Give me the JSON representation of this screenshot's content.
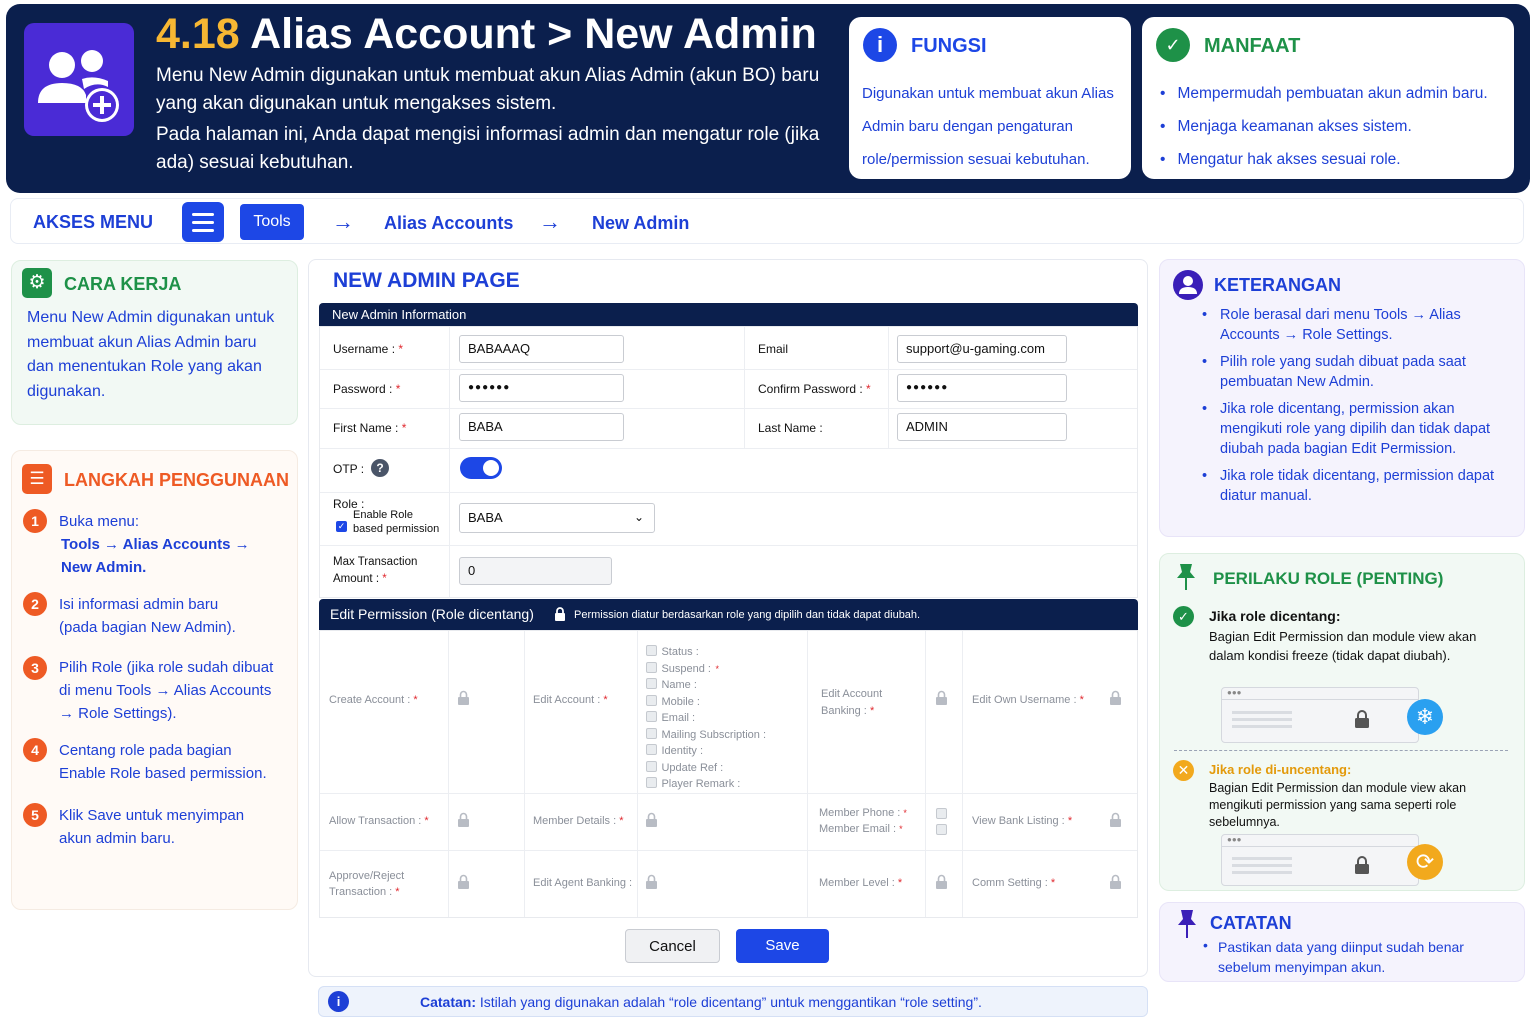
{
  "header": {
    "title_num": "4.18",
    "title_rest": "Alias Account > New Admin",
    "desc1": "Menu New Admin digunakan untuk membuat akun Alias Admin (akun BO) baru yang akan digunakan untuk mengakses sistem.",
    "desc2": "Pada halaman ini, Anda dapat mengisi informasi admin dan mengatur role (jika ada) sesuai kebutuhan.",
    "fungsi": {
      "title": "FUNGSI",
      "icon": "info-icon",
      "text": "Digunakan untuk membuat akun Alias Admin baru dengan pengaturan role/permission sesuai kebutuhan."
    },
    "manfaat": {
      "title": "MANFAAT",
      "icon": "check-circle-icon",
      "items": [
        "Mempermudah pembuatan akun admin baru.",
        "Menjaga keamanan akses sistem.",
        "Mengatur hak akses sesuai role."
      ]
    }
  },
  "akses": {
    "title": "AKSES MENU",
    "tools": "Tools",
    "crumb1": "Alias Accounts",
    "crumb2": "New Admin"
  },
  "cara": {
    "title": "CARA KERJA",
    "text": "Menu New Admin digunakan untuk membuat akun Alias Admin baru dan menentukan Role yang akan digunakan."
  },
  "langkah": {
    "title": "LANGKAH PENGGUNAAN",
    "steps": [
      {
        "n": "1",
        "a": "Buka menu:",
        "b": "Tools → Alias Accounts →",
        "c": "New Admin."
      },
      {
        "n": "2",
        "a": "Isi informasi admin baru",
        "b": "(pada bagian New Admin)."
      },
      {
        "n": "3",
        "a": "Pilih Role (jika role sudah dibuat",
        "b": "di menu Tools → Alias Accounts",
        "c": "→ Role Settings)."
      },
      {
        "n": "4",
        "a": "Centang role pada bagian",
        "b": "Enable Role based permission."
      },
      {
        "n": "5",
        "a": "Klik Save untuk menyimpan",
        "b": "akun admin baru."
      }
    ]
  },
  "form": {
    "page_title": "NEW ADMIN PAGE",
    "section1": "New Admin Information",
    "username_label": "Username :",
    "username_value": "BABAAAQ",
    "email_label": "Email",
    "email_value": "support@u-gaming.com",
    "password_label": "Password :",
    "password_value": "●●●●●●",
    "confirm_label": "Confirm Password :",
    "confirm_value": "●●●●●●",
    "first_label": "First Name :",
    "first_value": "BABA",
    "last_label": "Last Name :",
    "last_value": "ADMIN",
    "otp_label": "OTP :",
    "otp_help": "?",
    "otp_enabled": true,
    "role_label": "Role :",
    "enable_role_1": "Enable Role",
    "enable_role_2": "based permission",
    "enable_role_checked": true,
    "role_value": "BABA",
    "max_label_1": "Max Transaction",
    "max_label_2": "Amount :",
    "max_value": "0",
    "section2": "Edit Permission (Role dicentang)",
    "section2_note": "Permission diatur berdasarkan role yang dipilih dan tidak dapat diubah.",
    "perm": {
      "create": "Create Account :",
      "edit": "Edit Account :",
      "sub": [
        "Status :",
        "Suspend :",
        "Name :",
        "Mobile :",
        "Email :",
        "Mailing Subscription :",
        "Identity :",
        "Update Ref :",
        "Player Remark :"
      ],
      "eab1": "Edit Account",
      "eab2": "Banking :",
      "eou": "Edit Own Username :",
      "allow": "Allow Transaction :",
      "member_details": "Member Details :",
      "phone": "Member Phone :",
      "memail": "Member Email :",
      "vbl": "View Bank Listing :",
      "appr1": "Approve/Reject",
      "appr2": "Transaction :",
      "eagent": "Edit Agent Banking :",
      "mlevel": "Member Level :",
      "comm": "Comm Setting :"
    },
    "cancel": "Cancel",
    "save": "Save",
    "catatan_label": "Catatan:",
    "catatan_text": "Istilah yang digunakan adalah “role dicentang” untuk menggantikan “role setting”."
  },
  "keterangan": {
    "title": "KETERANGAN",
    "items": [
      "Role berasal dari menu Tools → Alias Accounts → Role Settings.",
      "Pilih role yang sudah dibuat pada saat pembuatan New Admin.",
      "Jika role dicentang, permission akan mengikuti role yang dipilih dan tidak dapat diubah pada bagian Edit Permission.",
      "Jika role tidak dicentang, permission dapat diatur manual."
    ]
  },
  "perilaku": {
    "title": "PERILAKU ROLE (PENTING)",
    "a_title": "Jika role dicentang:",
    "a_text": "Bagian Edit Permission dan module view akan dalam kondisi freeze (tidak dapat diubah).",
    "b_title": "Jika role di-uncentang:",
    "b_text": "Bagian Edit Permission dan module view akan mengikuti permission yang sama seperti role sebelumnya."
  },
  "catatan": {
    "title": "CATATAN",
    "text": "Pastikan data yang diinput sudah benar sebelum menyimpan akun."
  },
  "colors": {
    "navy": "#0b1f4d",
    "blue": "#1d47e6",
    "orange": "#ee5a24",
    "green": "#1e9148",
    "gold": "#f7b733"
  }
}
